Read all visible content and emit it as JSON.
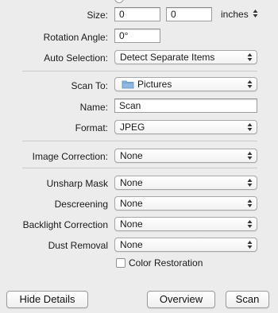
{
  "size": {
    "label": "Size:",
    "width": "0",
    "height": "0",
    "unit": "inches"
  },
  "rotation": {
    "label": "Rotation Angle:",
    "value": "0°"
  },
  "auto_selection": {
    "label": "Auto Selection:",
    "value": "Detect Separate Items"
  },
  "scan_to": {
    "label": "Scan To:",
    "value": "Pictures",
    "icon": "folder-icon"
  },
  "name": {
    "label": "Name:",
    "value": "Scan"
  },
  "format": {
    "label": "Format:",
    "value": "JPEG"
  },
  "image_correction": {
    "label": "Image Correction:",
    "value": "None"
  },
  "unsharp_mask": {
    "label": "Unsharp Mask",
    "value": "None"
  },
  "descreening": {
    "label": "Descreening",
    "value": "None"
  },
  "backlight_correction": {
    "label": "Backlight Correction",
    "value": "None"
  },
  "dust_removal": {
    "label": "Dust Removal",
    "value": "None"
  },
  "color_restoration": {
    "label": "Color Restoration",
    "checked": false
  },
  "buttons": {
    "hide_details": "Hide Details",
    "overview": "Overview",
    "scan": "Scan"
  }
}
